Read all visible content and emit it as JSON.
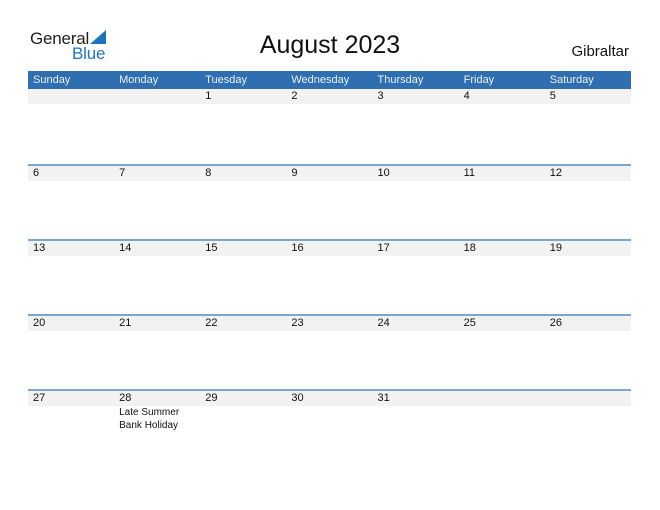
{
  "logo": {
    "word1": "General",
    "word2": "Blue"
  },
  "title": "August 2023",
  "country": "Gibraltar",
  "colors": {
    "header_bg": "#2f6fb0",
    "accent": "#1e73be",
    "row_band": "#f2f2f2",
    "separator": "#7aa6d4"
  },
  "weekdays": [
    "Sunday",
    "Monday",
    "Tuesday",
    "Wednesday",
    "Thursday",
    "Friday",
    "Saturday"
  ],
  "weeks": [
    {
      "days": [
        "",
        "",
        "1",
        "2",
        "3",
        "4",
        "5"
      ],
      "events": [
        "",
        "",
        "",
        "",
        "",
        "",
        ""
      ]
    },
    {
      "days": [
        "6",
        "7",
        "8",
        "9",
        "10",
        "11",
        "12"
      ],
      "events": [
        "",
        "",
        "",
        "",
        "",
        "",
        ""
      ]
    },
    {
      "days": [
        "13",
        "14",
        "15",
        "16",
        "17",
        "18",
        "19"
      ],
      "events": [
        "",
        "",
        "",
        "",
        "",
        "",
        ""
      ]
    },
    {
      "days": [
        "20",
        "21",
        "22",
        "23",
        "24",
        "25",
        "26"
      ],
      "events": [
        "",
        "",
        "",
        "",
        "",
        "",
        ""
      ]
    },
    {
      "days": [
        "27",
        "28",
        "29",
        "30",
        "31",
        "",
        ""
      ],
      "events": [
        "",
        "Late Summer Bank Holiday",
        "",
        "",
        "",
        "",
        ""
      ]
    }
  ]
}
